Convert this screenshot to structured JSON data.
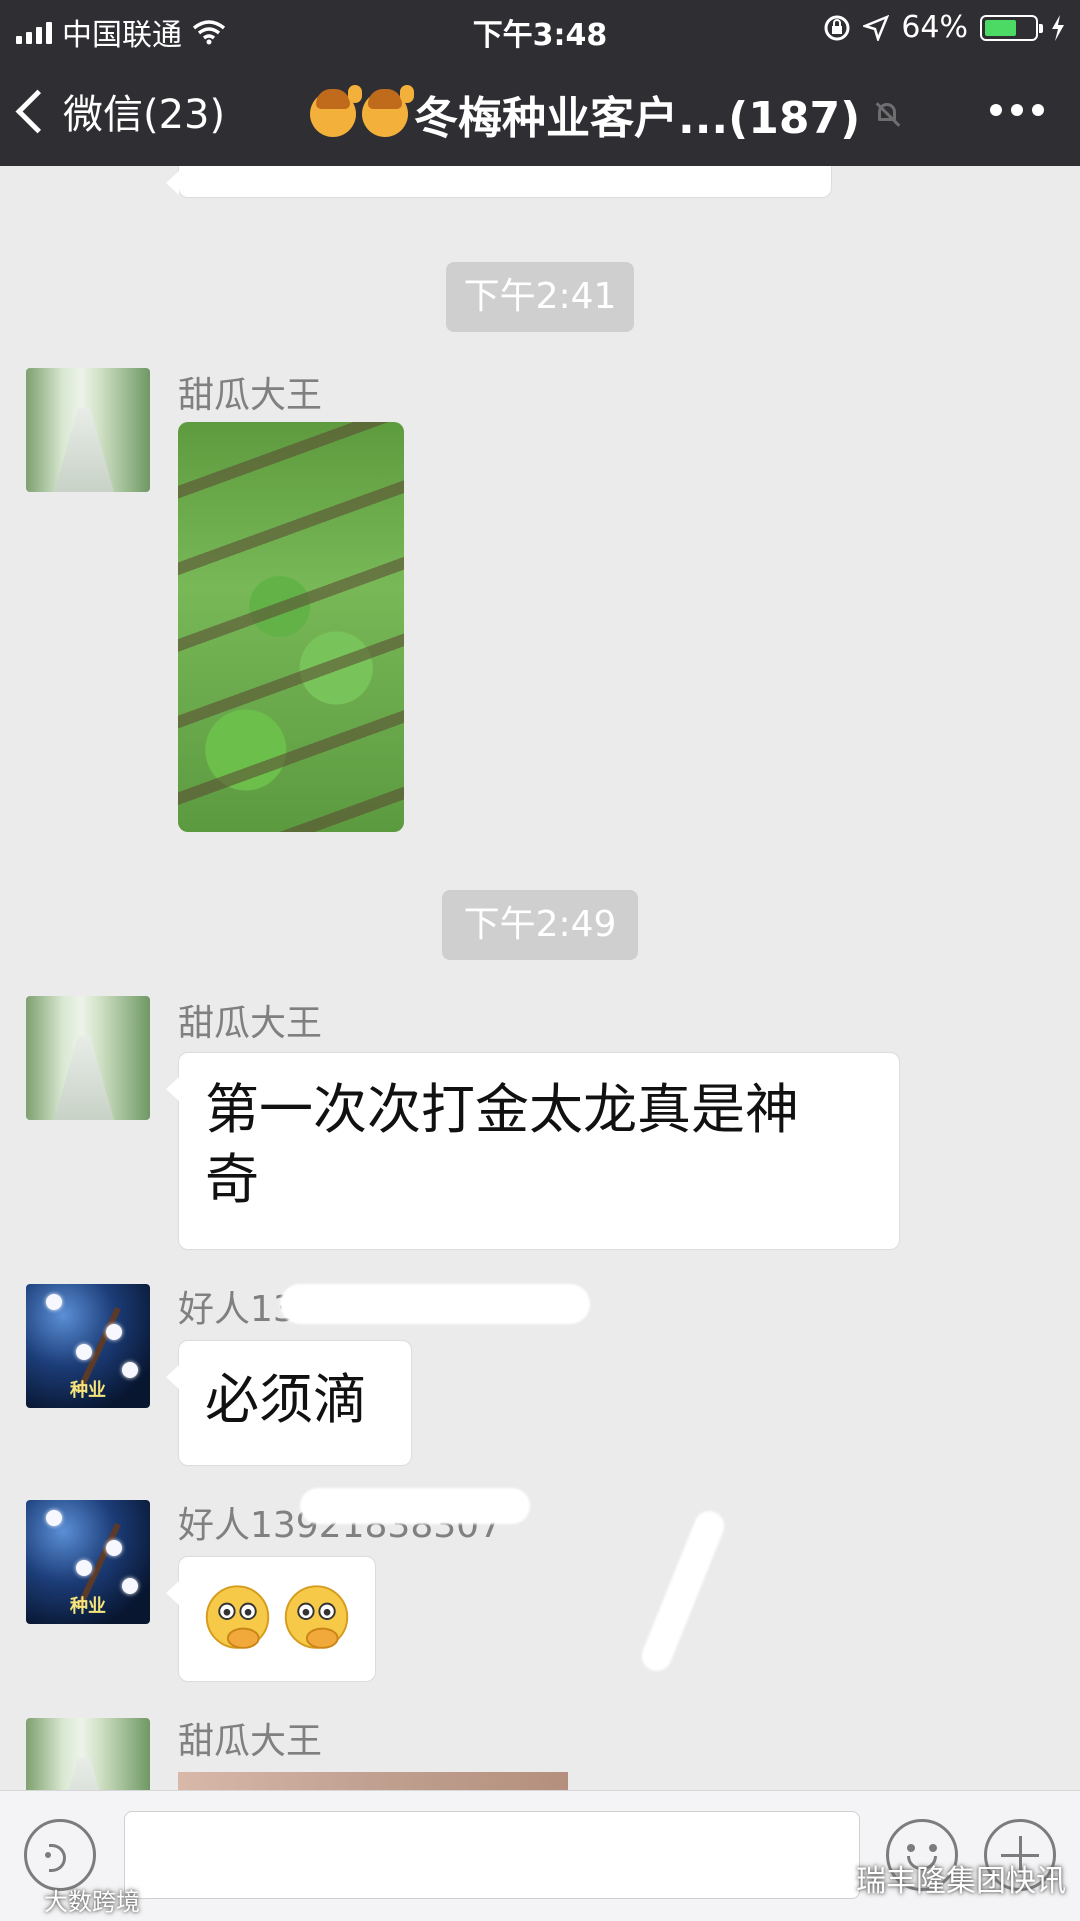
{
  "status": {
    "carrier": "中国联通",
    "time": "下午3:48",
    "battery_percent": "64%",
    "battery_level": 0.64,
    "battery_color": "#4cd964"
  },
  "header": {
    "back_label": "微信(23)",
    "title": "冬梅种业客户...(187)",
    "title_emoji_count": 2,
    "background": "#2f2f33"
  },
  "messages": [
    {
      "kind": "timestamp",
      "text": "下午2:41"
    },
    {
      "kind": "image",
      "sender": "甜瓜大王",
      "image": "cabbage-field-photo"
    },
    {
      "kind": "timestamp",
      "text": "下午2:49"
    },
    {
      "kind": "text",
      "sender": "甜瓜大王",
      "text_line1": "第一次次打金太龙真是神",
      "text_line2": "奇"
    },
    {
      "kind": "text",
      "sender": "好人13",
      "text": "必须滴"
    },
    {
      "kind": "emoji",
      "sender": "好人13921838307",
      "emoji": "two-thinking-hand-emoji"
    },
    {
      "kind": "image",
      "sender": "甜瓜大王",
      "image": "partial-photo"
    }
  ],
  "avatar_labels": {
    "plum": "种业"
  },
  "watermarks": {
    "left": "大数跨境",
    "right": "瑞丰隆集团快讯"
  },
  "icons": [
    "signal-icon",
    "wifi-icon",
    "lock-rotation-icon",
    "location-arrow-icon",
    "battery-icon",
    "charging-icon",
    "back-chevron-icon",
    "mute-bell-icon",
    "more-icon",
    "voice-icon",
    "emoji-icon",
    "plus-icon"
  ]
}
